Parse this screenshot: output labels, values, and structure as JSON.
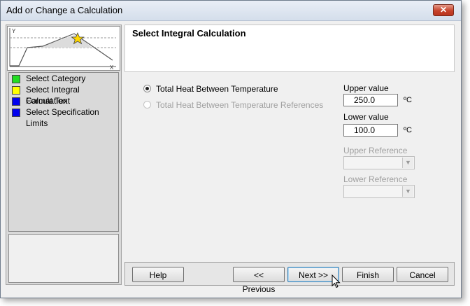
{
  "window": {
    "title": "Add or Change a Calculation",
    "close_glyph": "✕"
  },
  "graph": {
    "y_label": "Y",
    "x_label": "X"
  },
  "steps": [
    {
      "label": "Select Category",
      "color": "#22dd22"
    },
    {
      "label": "Select Integral Calculation",
      "color": "#ffff00"
    },
    {
      "label": "Format Text",
      "color": "#0000ee"
    },
    {
      "label": "Select Specification Limits",
      "color": "#0000ee"
    }
  ],
  "header": {
    "title": "Select Integral Calculation"
  },
  "options": {
    "option1": {
      "label": "Total Heat Between Temperature",
      "selected": true
    },
    "option2": {
      "label": "Total Heat Between Temperature References",
      "enabled": false
    }
  },
  "fields": {
    "upper_label": "Upper value",
    "upper_value": "250.0",
    "upper_unit": "ºC",
    "lower_label": "Lower value",
    "lower_value": "100.0",
    "lower_unit": "ºC",
    "upper_ref_label": "Upper Reference",
    "lower_ref_label": "Lower Reference",
    "upper_ref_value": "",
    "lower_ref_value": ""
  },
  "buttons": {
    "help": "Help",
    "previous": "<< Previous",
    "next": "Next >>",
    "finish": "Finish",
    "cancel": "Cancel"
  }
}
